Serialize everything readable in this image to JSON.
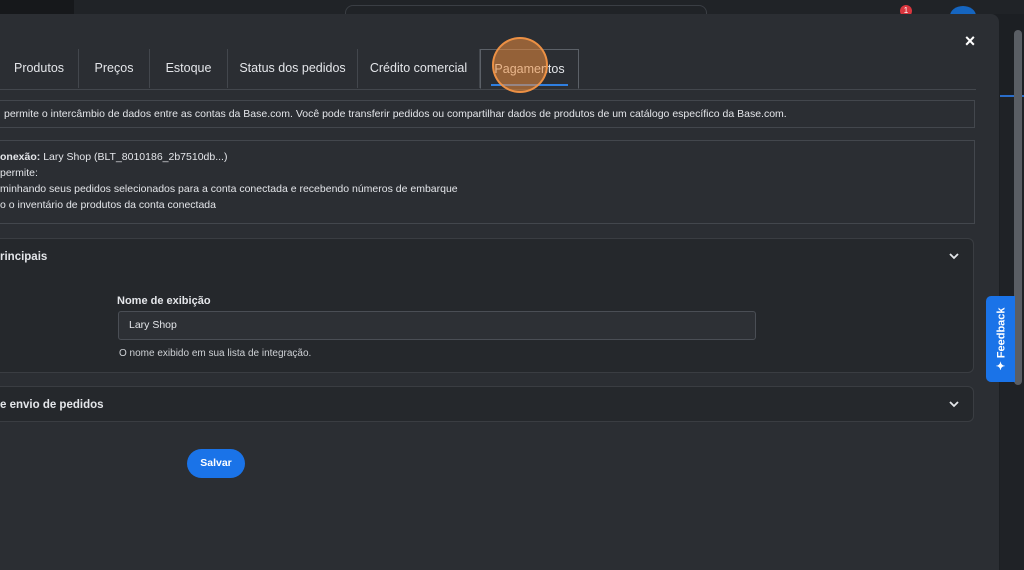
{
  "header": {
    "notification_count": "1"
  },
  "modal": {
    "close_label": "×",
    "tabs": [
      {
        "label": "Produtos"
      },
      {
        "label": "Preços"
      },
      {
        "label": "Estoque"
      },
      {
        "label": "Status dos pedidos"
      },
      {
        "label": "Crédito comercial"
      },
      {
        "label": "Pagamentos",
        "active": true
      }
    ],
    "info_text": "permite o intercâmbio de dados entre as contas da Base.com. Você pode transferir pedidos ou compartilhar dados de produtos de um catálogo específico da Base.com.",
    "connection": {
      "label": "onexão:",
      "value": "Lary Shop (BLT_8010186_2b7510db...)",
      "permits_label": "permite:",
      "items": [
        "minhando seus pedidos selecionados para a conta conectada e recebendo números de embarque",
        "o o inventário de produtos da conta conectada"
      ]
    },
    "sections": [
      {
        "title": "rincipais"
      },
      {
        "title": "e envio de pedidos"
      }
    ],
    "display_name": {
      "label": "Nome de exibição",
      "value": "Lary Shop",
      "help": "O nome exibido em sua lista de integração."
    },
    "save_label": "Salvar"
  },
  "feedback_label": "Feedback",
  "colors": {
    "accent": "#1a73e8",
    "modal_bg": "#2b2e33",
    "click_highlight": "#eb8c3c"
  }
}
